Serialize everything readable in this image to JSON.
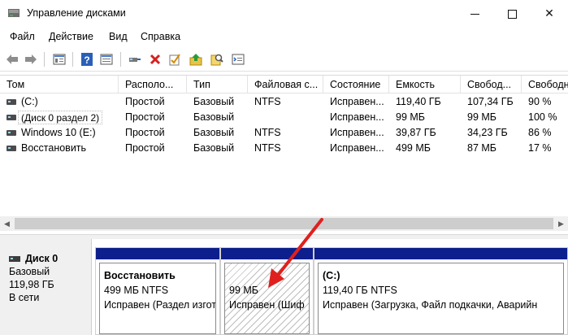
{
  "window": {
    "title": "Управление дисками",
    "minimize_glyph": "",
    "close_glyph": "✕"
  },
  "menu": [
    "Файл",
    "Действие",
    "Вид",
    "Справка"
  ],
  "toolbar": {
    "icons": [
      "back-arrow-icon",
      "forward-arrow-icon",
      "disk-list-icon",
      "help-icon",
      "properties-icon",
      "connect-drive-icon",
      "delete-icon",
      "checkmark-icon",
      "import-icon",
      "search-icon",
      "settings-icon"
    ]
  },
  "volumes": {
    "columns": [
      "Том",
      "Располо...",
      "Тип",
      "Файловая с...",
      "Состояние",
      "Емкость",
      "Свобод...",
      "Свободн"
    ],
    "rows": [
      {
        "name": "(C:)",
        "layout": "Простой",
        "type": "Базовый",
        "fs": "NTFS",
        "status": "Исправен...",
        "capacity": "119,40 ГБ",
        "free": "107,34 ГБ",
        "free_pct": "90 %"
      },
      {
        "name": "(Диск 0 раздел 2)",
        "layout": "Простой",
        "type": "Базовый",
        "fs": "",
        "status": "Исправен...",
        "capacity": "99 МБ",
        "free": "99 МБ",
        "free_pct": "100 %"
      },
      {
        "name": "Windows 10 (E:)",
        "layout": "Простой",
        "type": "Базовый",
        "fs": "NTFS",
        "status": "Исправен...",
        "capacity": "39,87 ГБ",
        "free": "34,23 ГБ",
        "free_pct": "86 %"
      },
      {
        "name": "Восстановить",
        "layout": "Простой",
        "type": "Базовый",
        "fs": "NTFS",
        "status": "Исправен...",
        "capacity": "499 МБ",
        "free": "87 МБ",
        "free_pct": "17 %"
      }
    ]
  },
  "disk": {
    "name": "Диск 0",
    "type": "Базовый",
    "size": "119,98 ГБ",
    "state": "В сети",
    "partitions": [
      {
        "title": "Восстановить",
        "size": "499 МБ NTFS",
        "status": "Исправен (Раздел изгот"
      },
      {
        "title": "",
        "size": "99 МБ",
        "status": "Исправен (Шиф"
      },
      {
        "title": "(C:)",
        "size": "119,40 ГБ NTFS",
        "status": "Исправен (Загрузка, Файл подкачки, Аварийн"
      }
    ]
  },
  "colors": {
    "partition_bar": "#0d1f8c",
    "annotation_arrow": "#e0201e"
  }
}
